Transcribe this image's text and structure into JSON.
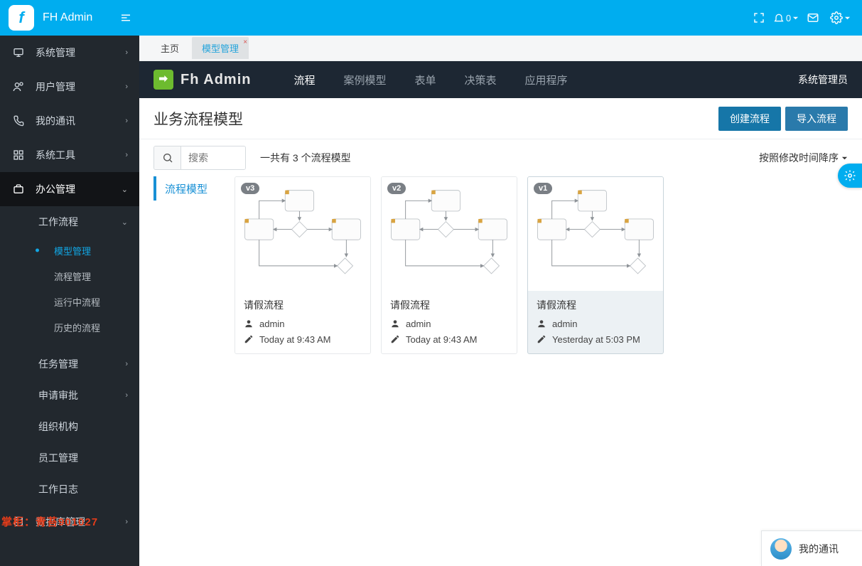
{
  "header": {
    "brand": "FH Admin",
    "bell_count": "0"
  },
  "sidebar": {
    "items": [
      {
        "icon": "monitor",
        "label": "系统管理",
        "caret": true
      },
      {
        "icon": "user",
        "label": "用户管理",
        "caret": true
      },
      {
        "icon": "phone",
        "label": "我的通讯",
        "caret": true
      },
      {
        "icon": "grid",
        "label": "系统工具",
        "caret": true
      },
      {
        "icon": "briefcase",
        "label": "办公管理",
        "caret": true,
        "active": true,
        "children": [
          {
            "label": "工作流程",
            "caret": true,
            "expanded": true,
            "children": [
              {
                "label": "模型管理",
                "active": true
              },
              {
                "label": "流程管理"
              },
              {
                "label": "运行中流程"
              },
              {
                "label": "历史的流程"
              }
            ]
          },
          {
            "label": "任务管理",
            "caret": true
          },
          {
            "label": "申请审批",
            "caret": true
          },
          {
            "label": "组织机构"
          },
          {
            "label": "员工管理"
          },
          {
            "label": "工作日志"
          }
        ]
      },
      {
        "icon": "database",
        "label": "数据库管理",
        "caret": true
      }
    ],
    "watermark": "掌柜：青苔901027"
  },
  "tabs": [
    {
      "label": "主页",
      "active": false
    },
    {
      "label": "模型管理",
      "active": true,
      "closable": true
    }
  ],
  "inner_nav": {
    "brand": "Fh Admin",
    "items": [
      "流程",
      "案例模型",
      "表单",
      "决策表",
      "应用程序"
    ],
    "active_index": 0,
    "right_label": "系统管理员"
  },
  "page": {
    "title": "业务流程模型",
    "btn_create": "创建流程",
    "btn_import": "导入流程",
    "search_placeholder": "搜索",
    "count_text": "一共有 3 个流程模型",
    "sort_label": "按照修改时间降序",
    "mini_tab": "流程模型"
  },
  "cards": [
    {
      "version": "v3",
      "title": "请假流程",
      "author": "admin",
      "time": "Today at 9:43 AM",
      "selected": false
    },
    {
      "version": "v2",
      "title": "请假流程",
      "author": "admin",
      "time": "Today at 9:43 AM",
      "selected": false
    },
    {
      "version": "v1",
      "title": "请假流程",
      "author": "admin",
      "time": "Yesterday at 5:03 PM",
      "selected": true
    }
  ],
  "chat": {
    "label": "我的通讯"
  }
}
